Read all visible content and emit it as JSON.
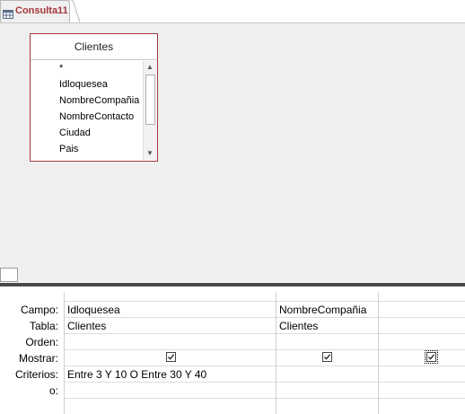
{
  "tab": {
    "title": "Consulta11",
    "icon": "query-icon"
  },
  "table": {
    "title": "Clientes",
    "fields": [
      "*",
      "Idloquesea",
      "NombreCompañia",
      "NombreContacto",
      "Ciudad",
      "Pais"
    ]
  },
  "grid": {
    "row_labels": [
      "Campo:",
      "Tabla:",
      "Orden:",
      "Mostrar:",
      "Criterios:",
      "o:"
    ],
    "columns": [
      {
        "campo": "Idloquesea",
        "tabla": "Clientes",
        "orden": "",
        "mostrar": true,
        "criterios": "Entre 3 Y 10 O Entre 30 Y 40",
        "o": ""
      },
      {
        "campo": "NombreCompañia",
        "tabla": "Clientes",
        "orden": "",
        "mostrar": true,
        "criterios": "",
        "o": ""
      },
      {
        "campo": "",
        "tabla": "",
        "orden": "",
        "mostrar": true,
        "criterios": "",
        "o": ""
      }
    ]
  },
  "colors": {
    "accent": "#a4373a",
    "splitter": "#4a4a4a",
    "design_bg": "#efefef"
  }
}
